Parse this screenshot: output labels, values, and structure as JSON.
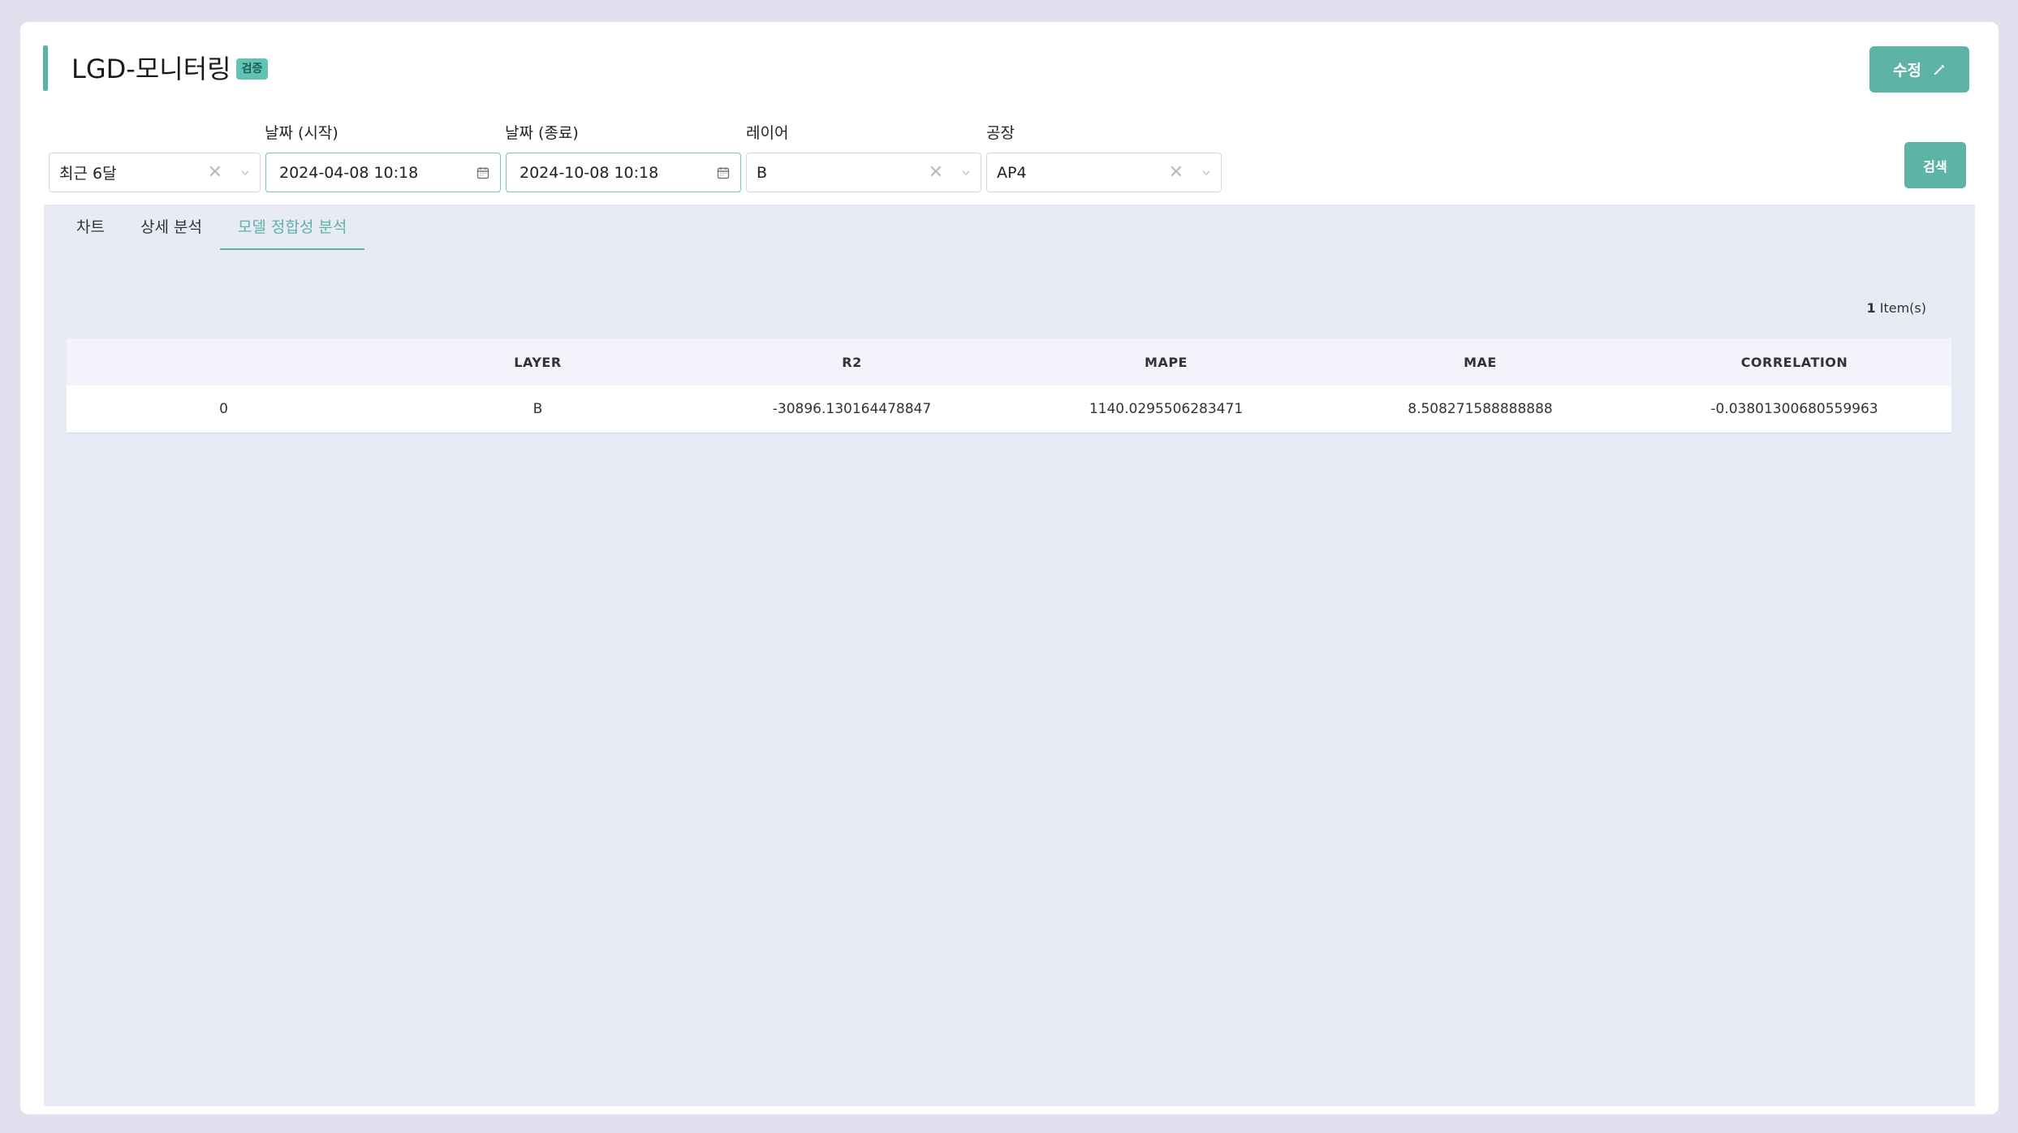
{
  "header": {
    "title": "LGD-모니터링",
    "badge": "검증",
    "edit_label": "수정"
  },
  "filters": {
    "period": {
      "value": "최근 6달"
    },
    "start_date": {
      "label": "날짜 (시작)",
      "value": "2024-04-08 10:18"
    },
    "end_date": {
      "label": "날짜 (종료)",
      "value": "2024-10-08 10:18"
    },
    "layer": {
      "label": "레이어",
      "value": "B"
    },
    "factory": {
      "label": "공장",
      "value": "AP4"
    },
    "search_label": "검색"
  },
  "tabs": [
    {
      "label": "차트"
    },
    {
      "label": "상세 분석"
    },
    {
      "label": "모델 정합성 분석"
    }
  ],
  "table": {
    "count": "1",
    "count_suffix": " Item(s)",
    "columns": [
      "",
      "LAYER",
      "R2",
      "MAPE",
      "MAE",
      "CORRELATION"
    ],
    "rows": [
      [
        "0",
        "B",
        "-30896.130164478847",
        "1140.0295506283471",
        "8.508271588888888",
        "-0.03801300680559963"
      ]
    ]
  },
  "colors": {
    "accent": "#5cb3a6",
    "panel": "#e8eaf5",
    "background": "#e2e0ee"
  }
}
